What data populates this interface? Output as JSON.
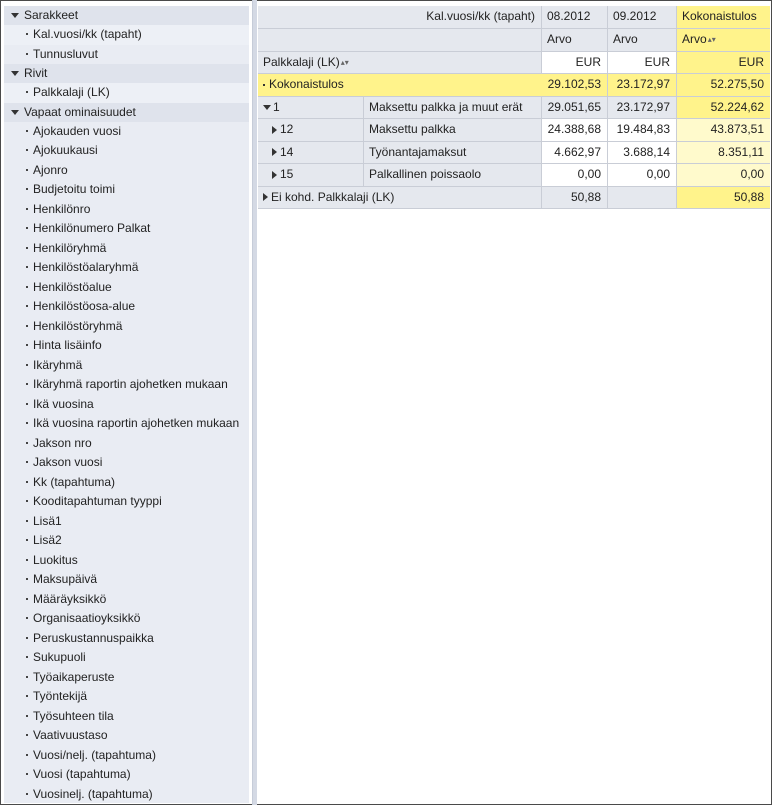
{
  "nav": {
    "sections": [
      {
        "label": "Sarakkeet",
        "items": [
          "Kal.vuosi/kk (tapaht)",
          "Tunnusluvut"
        ]
      },
      {
        "label": "Rivit",
        "items": [
          "Palkkalaji (LK)"
        ]
      },
      {
        "label": "Vapaat ominaisuudet",
        "items": [
          "Ajokauden vuosi",
          "Ajokuukausi",
          "Ajonro",
          "Budjetoitu toimi",
          "Henkilönro",
          "Henkilönumero Palkat",
          "Henkilöryhmä",
          "Henkilöstöalaryhmä",
          "Henkilöstöalue",
          "Henkilöstöosa-alue",
          "Henkilöstöryhmä",
          "Hinta lisäinfo",
          "Ikäryhmä",
          "Ikäryhmä raportin ajohetken mukaan",
          "Ikä vuosina",
          "Ikä vuosina raportin ajohetken mukaan",
          "Jakson nro",
          "Jakson vuosi",
          "Kk (tapahtuma)",
          "Kooditapahtuman tyyppi",
          "Lisä1",
          "Lisä2",
          "Luokitus",
          "Maksupäivä",
          "Määräyksikkö",
          "Organisaatioyksikkö",
          "Peruskustannuspaikka",
          "Sukupuoli",
          "Työaikaperuste",
          "Työntekijä",
          "Työsuhteen tila",
          "Vaativuustaso",
          "Vuosi/nelj. (tapahtuma)",
          "Vuosi (tapahtuma)",
          "Vuosinelj. (tapahtuma)"
        ]
      }
    ]
  },
  "table": {
    "col_dim_label": "Kal.vuosi/kk (tapaht)",
    "columns": [
      "08.2012",
      "09.2012",
      "Kokonaistulos"
    ],
    "measure": "Arvo",
    "unit": "EUR",
    "row_dim_label": "Palkkalaji (LK)",
    "sort_glyph": "▴▾",
    "total": {
      "label": "Kokonaistulos",
      "values": [
        "29.102,53",
        "23.172,97",
        "52.275,50"
      ]
    },
    "rows": [
      {
        "code": "1",
        "name": "Maksettu palkka ja muut erät",
        "values": [
          "29.051,65",
          "23.172,97",
          "52.224,62"
        ]
      },
      {
        "code": "12",
        "name": "Maksettu palkka",
        "values": [
          "24.388,68",
          "19.484,83",
          "43.873,51"
        ]
      },
      {
        "code": "14",
        "name": "Työnantajamaksut",
        "values": [
          "4.662,97",
          "3.688,14",
          "8.351,11"
        ]
      },
      {
        "code": "15",
        "name": "Palkallinen poissaolo",
        "values": [
          "0,00",
          "0,00",
          "0,00"
        ]
      }
    ],
    "unassigned": {
      "label": "Ei kohd. Palkkalaji (LK)",
      "values": [
        "50,88",
        "",
        "50,88"
      ]
    }
  },
  "colors": {
    "highlight": "#fff38b",
    "header_grey": "#e5e8ee",
    "nav_bg": "#e9ecf3"
  }
}
